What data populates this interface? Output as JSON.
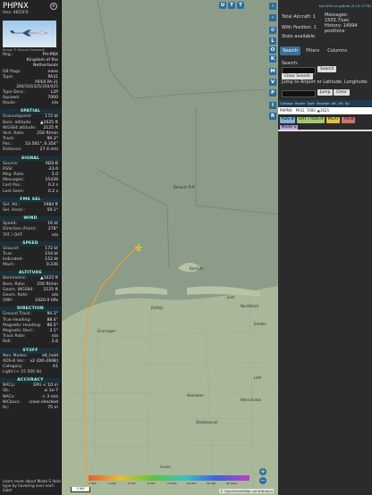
{
  "aircraft": {
    "callsign": "PHPNX",
    "hex_line": "Hex: 4855F6",
    "photo_credit": "Image © Manuel Estevesill"
  },
  "info_rows": [
    {
      "k": "Reg.:",
      "v": "PH-PNX"
    },
    {
      "k": "",
      "v": "Kingdom of the"
    },
    {
      "k": "",
      "v": "Netherlands"
    },
    {
      "k": "DB flags:",
      "v": "none"
    },
    {
      "k": "Type:",
      "v": "PA31"
    }
  ],
  "type_desc": "PIPER PA-31 200/310/325/350/425",
  "info_rows2": [
    {
      "k": "Type Desc.:",
      "v": "L2P"
    },
    {
      "k": "Squawk:",
      "v": "7000"
    },
    {
      "k": "Route:",
      "v": "n/a"
    }
  ],
  "sections": [
    {
      "title": "SPATIAL",
      "rows": [
        {
          "k": "Groundspeed:",
          "v": "172 kt"
        },
        {
          "k": "Baro. altitude:",
          "v": "▲1625 ft"
        },
        {
          "k": "WGS84 altitude:",
          "v": "2125 ft"
        },
        {
          "k": "Vert. Rate:",
          "v": "256 ft/min"
        },
        {
          "k": "Track:",
          "v": "90.3°"
        },
        {
          "k": "Pos.:",
          "v": "53.561°, 6.354°"
        },
        {
          "k": "Distance:",
          "v": "27.4 nmi"
        }
      ]
    },
    {
      "title": "SIGNAL",
      "rows": [
        {
          "k": "Source:",
          "v": "ADS-B"
        },
        {
          "k": "RSSI:",
          "v": "-23.6"
        },
        {
          "k": "Msg. Rate:",
          "v": "5.0"
        },
        {
          "k": "Messages:",
          "v": "15439"
        },
        {
          "k": "Last Pos.:",
          "v": "0.2 s"
        },
        {
          "k": "Last Seen:",
          "v": "0.2 s"
        }
      ]
    },
    {
      "title": "FMS SEL",
      "rows": [
        {
          "k": "Sel. Alt.:",
          "v": "1984 ft"
        },
        {
          "k": "Sel. Head.:",
          "v": "59.1°"
        }
      ]
    },
    {
      "title": "WIND",
      "rows": [
        {
          "k": "Speed:",
          "v": "16 kt"
        },
        {
          "k": "Direction (from):",
          "v": "278°"
        },
        {
          "k": "TAT / OAT:",
          "v": "n/a"
        }
      ]
    },
    {
      "title": "SPEED",
      "rows": [
        {
          "k": "Ground:",
          "v": "172 kt"
        },
        {
          "k": "True:",
          "v": "154 kt"
        },
        {
          "k": "Indicated:",
          "v": "152 kt"
        },
        {
          "k": "Mach:",
          "v": "0.236"
        }
      ]
    },
    {
      "title": "ALTITUDE",
      "rows": [
        {
          "k": "Barometric:",
          "v": "▲1625 ft"
        },
        {
          "k": "Baro. Rate:",
          "v": "256 ft/min"
        },
        {
          "k": "Geom. WGS84:",
          "v": "2125 ft"
        },
        {
          "k": "Geom. Rate:",
          "v": "n/a"
        },
        {
          "k": "QNH:",
          "v": "1020.0 hPa"
        }
      ]
    },
    {
      "title": "DIRECTION",
      "rows": [
        {
          "k": "Ground Track:",
          "v": "90.3°"
        },
        {
          "k": "True Heading:",
          "v": "88.4°"
        },
        {
          "k": "Magnetic Heading:",
          "v": "86.5°"
        },
        {
          "k": "Magnetic Decl.:",
          "v": "3.1°"
        },
        {
          "k": "Track Rate:",
          "v": "n/a"
        },
        {
          "k": "Roll:",
          "v": "2.6"
        }
      ]
    },
    {
      "title": "STUFF",
      "rows": [
        {
          "k": "Nav. Modes:",
          "v": "alt_hold"
        },
        {
          "k": "ADS-B Ver.:",
          "v": "v2 (DO-260B)"
        },
        {
          "k": "Category:",
          "v": "A1"
        },
        {
          "k": "Light (< 15 500 lb)",
          "v": ""
        }
      ]
    },
    {
      "title": "ACCURACY",
      "rows": [
        {
          "k": "NACp:",
          "v": "EPU < 10 m"
        },
        {
          "k": "SIL:",
          "v": "≤ 1e-7"
        },
        {
          "k": "NACv:",
          "v": "< 3 m/s"
        },
        {
          "k": "NICbaro:",
          "v": "cross-checked"
        },
        {
          "k": "Rc:",
          "v": "75 m"
        }
      ]
    }
  ],
  "footer_tip": "Learn more about Mode S data type by hovering over each label",
  "map": {
    "place_labels": [
      "Borkum Riff",
      "Borkum",
      "Juist",
      "Norddeich",
      "Groningen",
      "Delfzijl",
      "Emden",
      "Leer",
      "Winschoten",
      "Stadskanaal",
      "Veendam",
      "Assen"
    ],
    "top_buttons": [
      "U",
      "T",
      "T"
    ],
    "side_buttons": [
      "L",
      "O",
      "K",
      "M",
      "V",
      "P",
      "I",
      "R"
    ],
    "zoom_in": "+",
    "zoom_out": "−",
    "scale_label": "5 NM",
    "attribution": "© OpenStreetMap contributors",
    "alt_scale_labels": [
      "2 000",
      "4 000",
      "6 000",
      "8 000",
      "10 000",
      "20 000",
      "30 000",
      "40 000+"
    ]
  },
  "right": {
    "version_link": "tar1090 on github (3.14.1778)",
    "total_aircraft": "Total Aircraft: 1",
    "with_position": "With Position: 1",
    "stats_available": "Stats available",
    "messages": "Messages: 1503.7/sec",
    "history": "History: 14994 positions",
    "tabs": [
      "Search",
      "Filters",
      "Columns"
    ],
    "search_label": "Search:",
    "search_button": "Search",
    "clear_search": "Clear Search",
    "jump_label": "Jump to Airport or Latitude, Longitude:",
    "jump_button": "Jump",
    "clear_button": "Clear",
    "table_headers": [
      "Callsign",
      "Route",
      "Type",
      "Squawk",
      "Alt. (ft)",
      "Sp"
    ],
    "table_row": [
      "PHPNX",
      "",
      "PA31",
      "7000",
      "▲1625",
      ""
    ],
    "badges": [
      {
        "text": "ADS-B",
        "color": "#7fb3d6"
      },
      {
        "text": "UAT / ADS-R",
        "color": "#a4c870"
      },
      {
        "text": "MLAT",
        "color": "#e0c040"
      },
      {
        "text": "TIS-B",
        "color": "#d07070"
      },
      {
        "text": "Mode-S",
        "color": "#c0a0e0"
      }
    ]
  },
  "colors": {
    "accent": "#2d6b9b",
    "track": "#e8a040",
    "land": "#9aaf8f",
    "sea": "#8b9c88"
  }
}
